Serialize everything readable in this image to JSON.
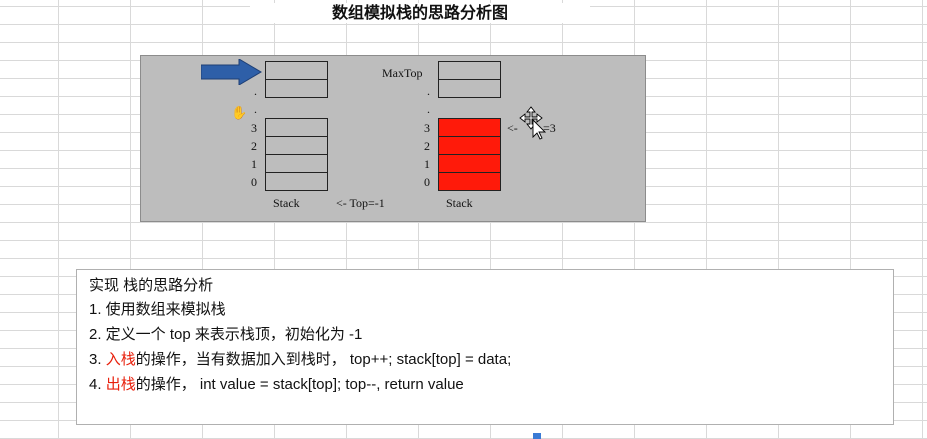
{
  "title": "数组模拟栈的思路分析图",
  "diagram": {
    "left_stack": {
      "bottom_label": "Stack",
      "index_labels": [
        "3",
        "2",
        "1",
        "0"
      ],
      "dots": [
        ".",
        "."
      ]
    },
    "top_note": "<- Top=-1",
    "right_stack": {
      "top_label": "MaxTop",
      "bottom_label": "Stack",
      "index_labels": [
        "3",
        "2",
        "1",
        "0"
      ],
      "dots": [
        ".",
        "."
      ]
    },
    "right_note_prefix": "<-",
    "right_note_suffix": "=3",
    "colors": {
      "filled": "#ff1a0a",
      "arrow": "#2e5fa8",
      "background": "#bdbdbd"
    }
  },
  "analysis": {
    "heading": "实现 栈的思路分析",
    "line1": "1. 使用数组来模拟栈",
    "line2": "2. 定义一个 top  来表示栈顶，初始化为 -1",
    "line3_prefix": "3. ",
    "line3_red": "入栈",
    "line3_rest": "的操作，当有数据加入到栈时， top++;  stack[top] = data;",
    "line4_prefix": "4. ",
    "line4_red": "出栈",
    "line4_rest": "的操作， int value = stack[top]; top--, return value"
  }
}
